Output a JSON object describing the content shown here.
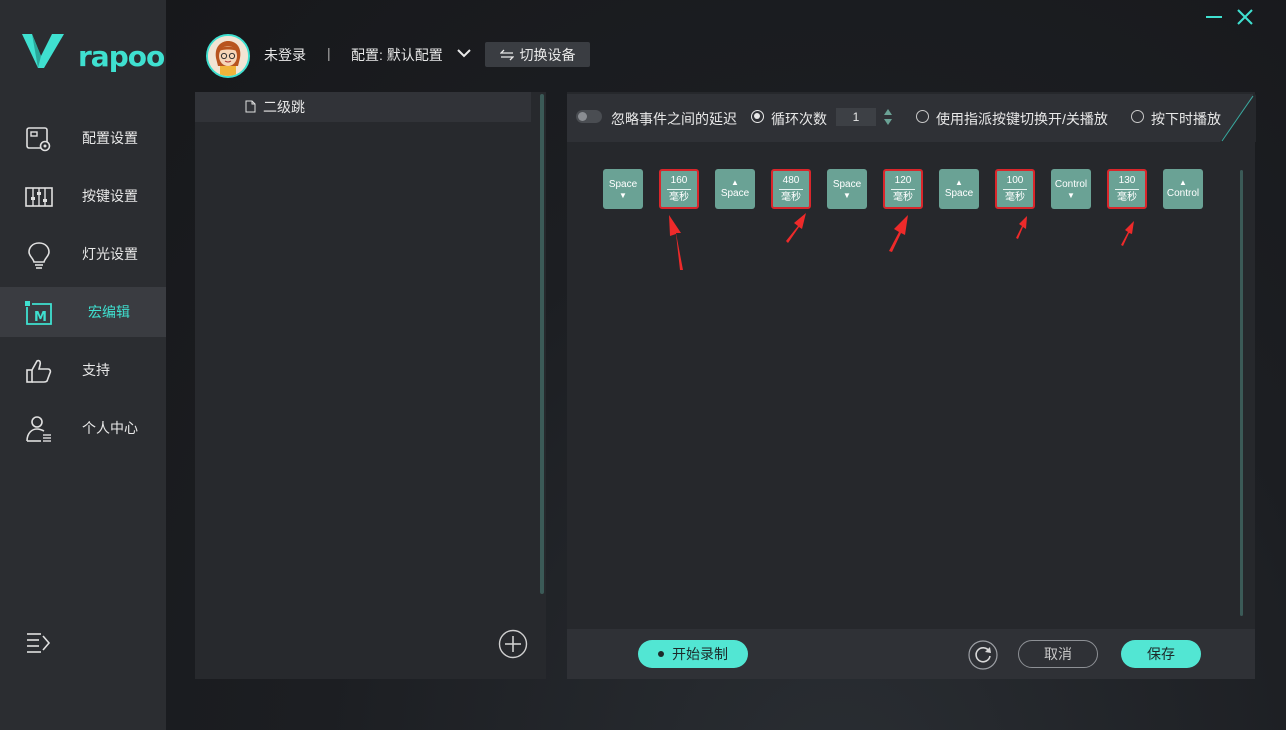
{
  "brand": {
    "logo_text": "rapoo",
    "accent": "#3fe0d0"
  },
  "sidebar": {
    "items": [
      {
        "label": "配置设置",
        "icon": "config-icon"
      },
      {
        "label": "按键设置",
        "icon": "key-sliders-icon"
      },
      {
        "label": "灯光设置",
        "icon": "lightbulb-icon"
      },
      {
        "label": "宏编辑",
        "icon": "macro-icon",
        "active": true
      },
      {
        "label": "支持",
        "icon": "thumbs-up-icon"
      },
      {
        "label": "个人中心",
        "icon": "user-icon"
      }
    ]
  },
  "header": {
    "login_status": "未登录",
    "separator": "|",
    "profile_label": "配置: 默认配置",
    "switch_device": "切换设备"
  },
  "macro_list": {
    "items": [
      {
        "label": "二级跳"
      }
    ]
  },
  "options": {
    "ignore_delay": "忽略事件之间的延迟",
    "loop_count_label": "循环次数",
    "loop_count_value": "1",
    "toggle_mode": "使用指派按键切换开/关播放",
    "hold_mode": "按下时播放"
  },
  "events": [
    {
      "type": "key",
      "key": "Space",
      "dir": "down"
    },
    {
      "type": "delay",
      "value": "160",
      "unit": "毫秒"
    },
    {
      "type": "key",
      "key": "Space",
      "dir": "up"
    },
    {
      "type": "delay",
      "value": "480",
      "unit": "毫秒"
    },
    {
      "type": "key",
      "key": "Space",
      "dir": "down"
    },
    {
      "type": "delay",
      "value": "120",
      "unit": "毫秒"
    },
    {
      "type": "key",
      "key": "Space",
      "dir": "up"
    },
    {
      "type": "delay",
      "value": "100",
      "unit": "毫秒"
    },
    {
      "type": "key",
      "key": "Control",
      "dir": "down"
    },
    {
      "type": "delay",
      "value": "130",
      "unit": "毫秒"
    },
    {
      "type": "key",
      "key": "Control",
      "dir": "up"
    }
  ],
  "footer": {
    "record": "开始录制",
    "cancel": "取消",
    "save": "保存"
  }
}
